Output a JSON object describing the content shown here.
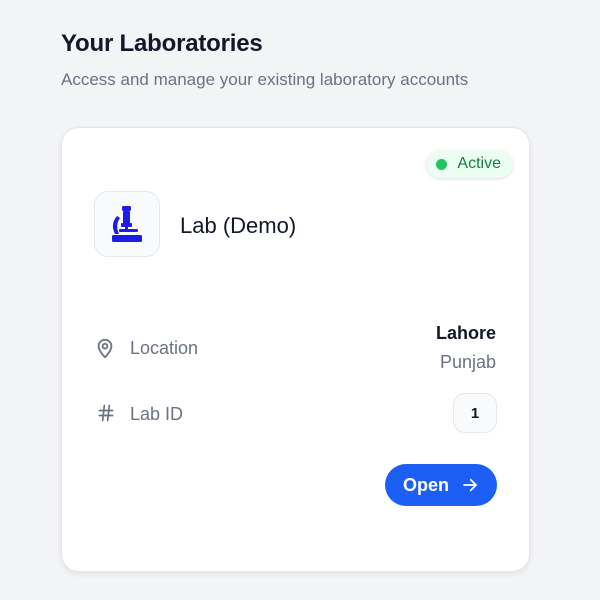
{
  "header": {
    "title": "Your Laboratories",
    "subtitle": "Access and manage your existing laboratory accounts"
  },
  "lab_card": {
    "status": "Active",
    "status_color": "#22c55e",
    "icon": "microscope-icon",
    "icon_color": "#1d1de6",
    "name": "Lab (Demo)",
    "location_label": "Location",
    "location_city": "Lahore",
    "location_region": "Punjab",
    "id_label": "Lab ID",
    "id_value": "1",
    "open_label": "Open",
    "accent_color": "#1d5ff5"
  }
}
